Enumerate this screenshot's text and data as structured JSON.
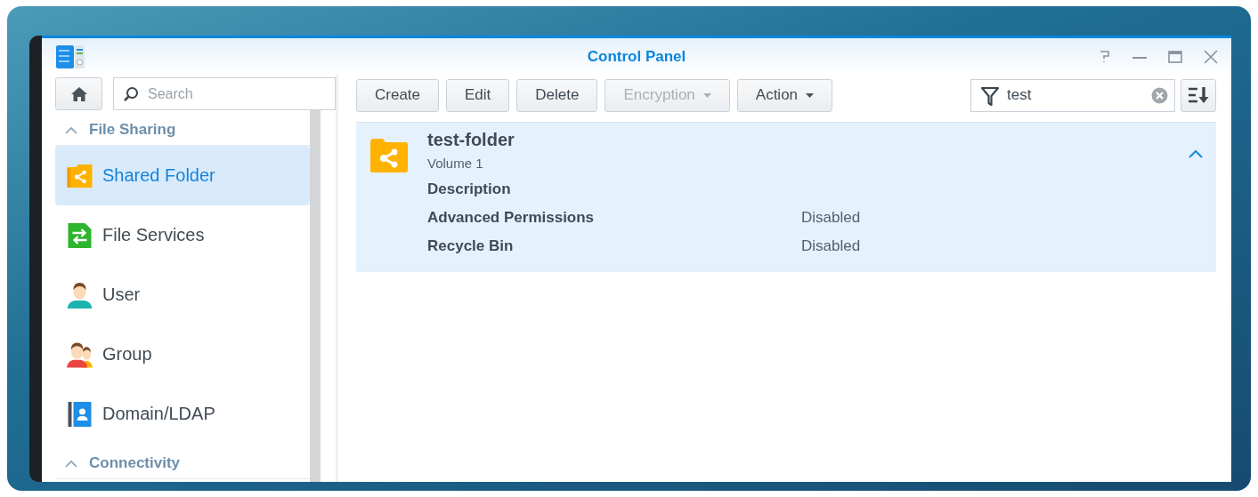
{
  "window": {
    "title": "Control Panel"
  },
  "sidebar": {
    "search": {
      "placeholder": "Search"
    },
    "sections": [
      {
        "title": "File Sharing",
        "expanded": true,
        "items": [
          {
            "label": "Shared Folder",
            "selected": true
          },
          {
            "label": "File Services",
            "selected": false
          },
          {
            "label": "User",
            "selected": false
          },
          {
            "label": "Group",
            "selected": false
          },
          {
            "label": "Domain/LDAP",
            "selected": false
          }
        ]
      },
      {
        "title": "Connectivity",
        "expanded": true
      }
    ]
  },
  "toolbar": {
    "buttons": [
      {
        "label": "Create",
        "disabled": false,
        "dropdown": false
      },
      {
        "label": "Edit",
        "disabled": false,
        "dropdown": false
      },
      {
        "label": "Delete",
        "disabled": false,
        "dropdown": false
      },
      {
        "label": "Encryption",
        "disabled": true,
        "dropdown": true
      },
      {
        "label": "Action",
        "disabled": false,
        "dropdown": true
      }
    ],
    "filter": {
      "value": "test"
    }
  },
  "folders": [
    {
      "name": "test-folder",
      "volume": "Volume 1",
      "expanded": true,
      "selected": true,
      "details": [
        {
          "label": "Description"
        },
        {
          "label": "Advanced Permissions",
          "value": "Disabled"
        },
        {
          "label": "Recycle Bin",
          "value": "Disabled"
        }
      ]
    }
  ]
}
